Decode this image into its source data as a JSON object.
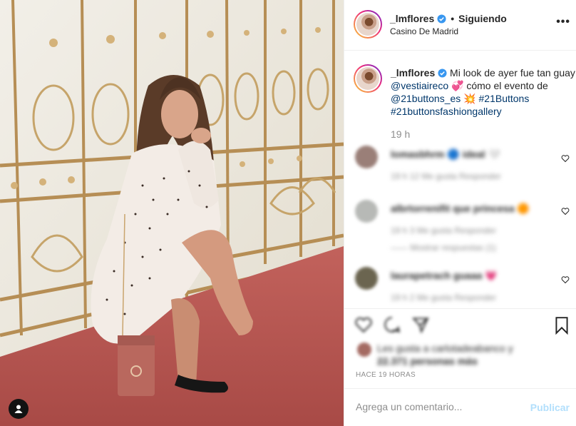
{
  "post": {
    "username": "_lmflores",
    "follow_status": "Siguiendo",
    "location": "Casino De Madrid",
    "more_glyph": "•••"
  },
  "caption": {
    "username": "_lmflores",
    "text_1": "Mi look de ayer fue tan guay",
    "mention_1": "@vestiaireco",
    "emoji_1": "💞",
    "text_2": "cómo el evento de",
    "mention_2": "@21buttons_es",
    "emoji_2": "💥",
    "hashtag_1": "#21Buttons",
    "hashtag_2": "#21buttonsfashiongallery",
    "time": "19 h"
  },
  "comments": [
    {
      "line1": "lomasbhrm 🔵 ideal 🤍",
      "line2": "19 h   12 Me gusta   Responder"
    },
    {
      "line1": "albrtorrenifit que princesa 🟠",
      "line2": "19 h   3 Me gusta   Responder",
      "line3": "——  Mostrar respuestas (1)"
    },
    {
      "line1": "laurapetrach guaaa 💗",
      "line2": "19 h   2 Me gusta   Responder"
    }
  ],
  "likes_text": {
    "line1": "Les gusta a carlotadeabanco y",
    "line2": "22.371 personas más"
  },
  "posted_ago": "HACE 19 HORAS",
  "add_comment": {
    "placeholder": "Agrega un comentario...",
    "publish_label": "Publicar"
  },
  "colors": {
    "link": "#00376b",
    "verified": "#3897f0",
    "publish_disabled": "#b2dffc",
    "carpet": "#b4534e"
  }
}
